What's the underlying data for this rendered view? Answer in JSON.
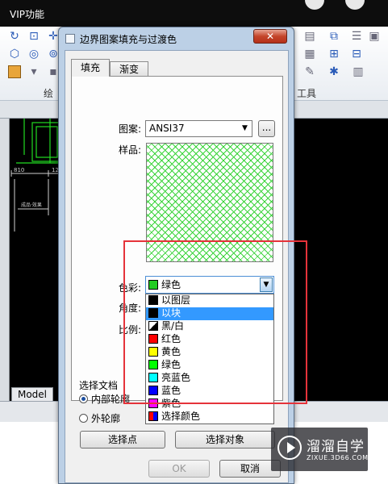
{
  "topbar": {
    "title": "VIP功能"
  },
  "ribbon": {
    "left_panel_label": "绘",
    "right_panel_label": "工具"
  },
  "cad": {
    "tab_model": "Model",
    "dim_left": "810",
    "dim_mid": "12",
    "text_small": "成品·效果"
  },
  "dialog": {
    "title": "边界图案填充与过渡色",
    "close_label": "✕",
    "tabs": [
      {
        "label": "填充"
      },
      {
        "label": "渐变"
      }
    ],
    "pattern": {
      "label": "图案:",
      "value": "ANSI37",
      "browse_label": "..."
    },
    "sample_label": "样品:",
    "color": {
      "label": "色彩:",
      "value": "绿色",
      "swatch": "#22cc22"
    },
    "angle_label": "角度:",
    "scale_label": "比例:",
    "color_options": [
      {
        "label": "以图层",
        "swatch": "#000000",
        "selected": false
      },
      {
        "label": "以块",
        "swatch": "#000000",
        "selected": true
      },
      {
        "label": "黑/白",
        "swatch": "black-white",
        "selected": false
      },
      {
        "label": "红色",
        "swatch": "#ff0000",
        "selected": false
      },
      {
        "label": "黄色",
        "swatch": "#ffff00",
        "selected": false
      },
      {
        "label": "绿色",
        "swatch": "#00ff00",
        "selected": false
      },
      {
        "label": "亮蓝色",
        "swatch": "#00ffff",
        "selected": false
      },
      {
        "label": "蓝色",
        "swatch": "#0000ff",
        "selected": false
      },
      {
        "label": "紫色",
        "swatch": "#ff00ff",
        "selected": false
      },
      {
        "label": "选择颜色",
        "swatch": "multi-color",
        "selected": false
      }
    ],
    "select_group": {
      "label": "选择文档",
      "option_inner": "内部轮廓",
      "option_outer": "外轮廓",
      "pick_points_label": "选择点",
      "select_objects_label": "选择对象"
    },
    "ok_label": "OK",
    "cancel_label": "取消"
  },
  "watermark": {
    "title": "溜溜自学",
    "url": "ZIXUE.3D66.COM"
  },
  "colors": {
    "accent_selection": "#3399ff",
    "highlight_box": "#e5333a",
    "hatch": "#3bd43b"
  }
}
